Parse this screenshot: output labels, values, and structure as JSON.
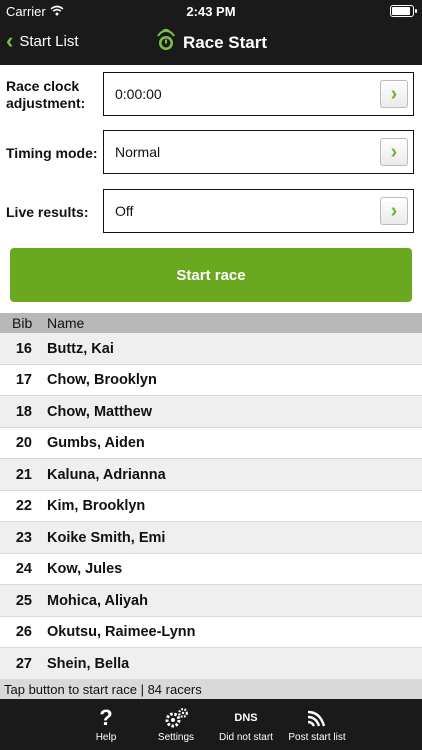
{
  "status_bar": {
    "carrier": "Carrier",
    "time": "2:43 PM"
  },
  "nav": {
    "back_label": "Start List",
    "title": "Race Start"
  },
  "settings": [
    {
      "label": "Race clock adjustment:",
      "value": "0:00:00"
    },
    {
      "label": "Timing mode:",
      "value": "Normal"
    },
    {
      "label": "Live results:",
      "value": "Off"
    }
  ],
  "start_button_label": "Start race",
  "table": {
    "headers": {
      "bib": "Bib",
      "name": "Name"
    },
    "rows": [
      {
        "bib": "16",
        "name": "Buttz, Kai"
      },
      {
        "bib": "17",
        "name": "Chow, Brooklyn"
      },
      {
        "bib": "18",
        "name": "Chow, Matthew"
      },
      {
        "bib": "20",
        "name": "Gumbs, Aiden"
      },
      {
        "bib": "21",
        "name": "Kaluna, Adrianna"
      },
      {
        "bib": "22",
        "name": "Kim, Brooklyn"
      },
      {
        "bib": "23",
        "name": "Koike Smith, Emi"
      },
      {
        "bib": "24",
        "name": "Kow, Jules"
      },
      {
        "bib": "25",
        "name": "Mohica, Aliyah"
      },
      {
        "bib": "26",
        "name": "Okutsu, Raimee-Lynn"
      },
      {
        "bib": "27",
        "name": "Shein, Bella"
      }
    ]
  },
  "footer_status": "Tap button to start race | 84 racers",
  "toolbar": {
    "help_label": "Help",
    "settings_label": "Settings",
    "dns_icon_text": "DNS",
    "dns_label": "Did not start",
    "post_label": "Post start list"
  },
  "colors": {
    "accent_green": "#6aa820",
    "bar_dark": "#1a1a1a"
  }
}
